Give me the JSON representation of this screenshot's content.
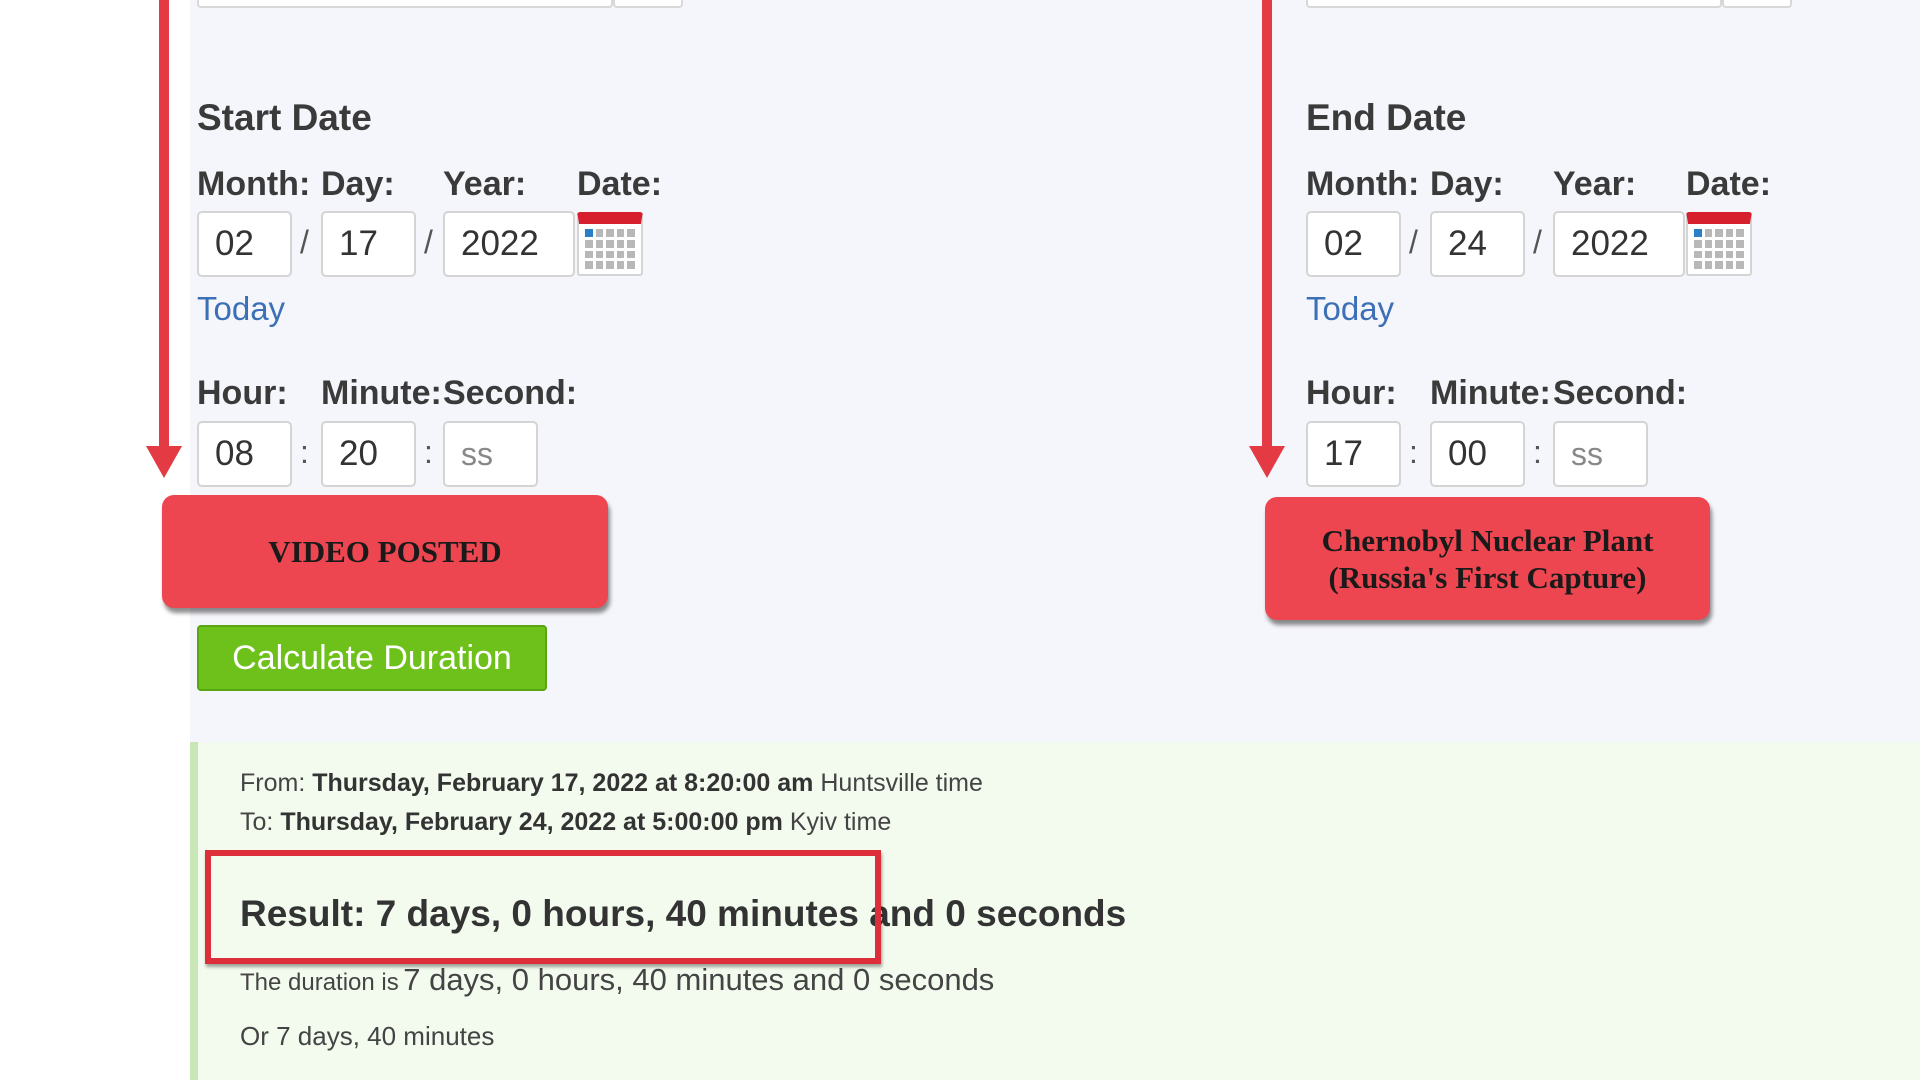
{
  "start": {
    "title": "Start Date",
    "labels": {
      "month": "Month:",
      "day": "Day:",
      "year": "Year:",
      "date": "Date:",
      "hour": "Hour:",
      "minute": "Minute:",
      "second": "Second:"
    },
    "month": "02",
    "day": "17",
    "year": "2022",
    "today_link": "Today",
    "hour": "08",
    "minute": "20",
    "second_placeholder": "ss",
    "annotation": "VIDEO POSTED"
  },
  "end": {
    "title": "End Date",
    "labels": {
      "month": "Month:",
      "day": "Day:",
      "year": "Year:",
      "date": "Date:",
      "hour": "Hour:",
      "minute": "Minute:",
      "second": "Second:"
    },
    "month": "02",
    "day": "24",
    "year": "2022",
    "today_link": "Today",
    "hour": "17",
    "minute": "00",
    "second_placeholder": "ss",
    "annotation_line1": "Chernobyl Nuclear Plant",
    "annotation_line2": "(Russia's First Capture)"
  },
  "separators": {
    "date": "/",
    "time": ":"
  },
  "calculate_button": "Calculate Duration",
  "result": {
    "from_prefix": "From:",
    "from_value": "Thursday, February 17, 2022 at 8:20:00 am",
    "from_suffix": "Huntsville time",
    "to_prefix": "To:",
    "to_value": "Thursday, February 24, 2022 at 5:00:00 pm",
    "to_suffix": "Kyiv time",
    "main": "Result: 7 days, 0 hours, 40 minutes and 0 seconds",
    "duration_prefix": "The duration is",
    "duration_value": "7 days, 0 hours, 40 minutes and 0 seconds",
    "alt": "Or 7 days, 40 minutes"
  },
  "colors": {
    "annotation_red": "#ee4650",
    "arrow_red": "#e33a44",
    "button_green": "#6ec11a",
    "link_blue": "#3b6fb6",
    "result_bg": "#f3fbee"
  }
}
